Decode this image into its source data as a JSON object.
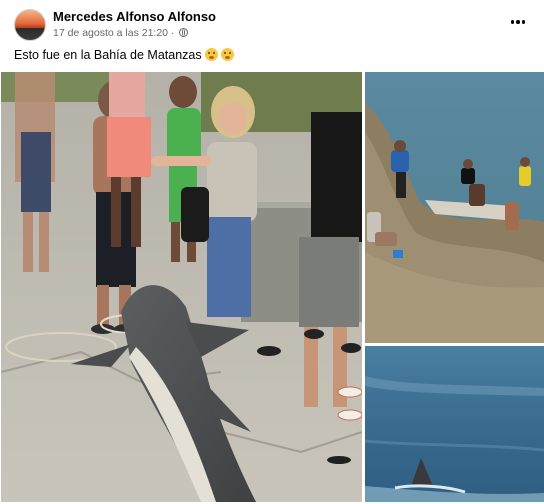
{
  "post": {
    "author_name": "Mercedes Alfonso Alfonso",
    "timestamp": "17 de agosto a las 21:20 · ",
    "privacy_icon": "globe-icon",
    "more_icon": "more-options-icon",
    "caption": "Esto fue en la Bahía de Matanzas",
    "caption_emojis": [
      "flushed-face-emoji",
      "flushed-face-emoji"
    ]
  },
  "photos": [
    {
      "name": "photo-shark-on-shore",
      "kind": "crowd around shark on concrete"
    },
    {
      "name": "photo-rocky-shore",
      "kind": "people on rocky shore by sea"
    },
    {
      "name": "photo-fin-in-water",
      "kind": "shark fin in water"
    }
  ],
  "colors": {
    "text_primary": "#050505",
    "text_secondary": "#65676b",
    "background": "#ffffff"
  }
}
